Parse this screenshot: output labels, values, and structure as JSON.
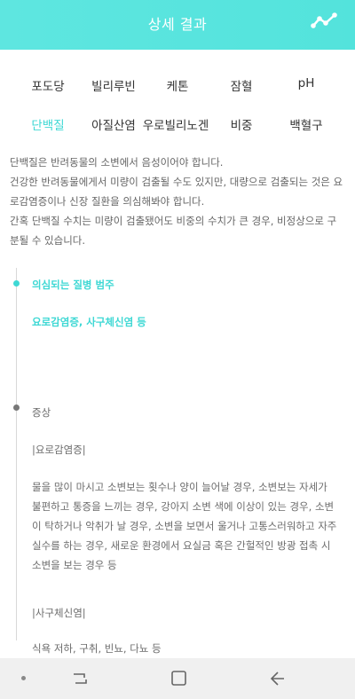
{
  "header": {
    "title": "상세 결과",
    "icon": "trend-line-icon"
  },
  "tabs": {
    "row1": [
      "포도당",
      "빌리루빈",
      "케톤",
      "잠혈",
      "pH"
    ],
    "row2": [
      "단백질",
      "아질산염",
      "우로빌리노겐",
      "비중",
      "백혈구"
    ],
    "active": "단백질"
  },
  "description": [
    "단백질은 반려동물의 소변에서 음성이어야 합니다.",
    "건강한 반려동물에게서 미량이 검출될 수도 있지만, 대량으로 검출되는 것은 요로감염증이나 신장 질환을 의심해봐야 합니다.",
    "간혹 단백질 수치는 미량이 검출됐어도 비중의 수치가 큰 경우, 비정상으로 구분될 수 있습니다."
  ],
  "timeline": {
    "category_label": "의심되는 질병 범주",
    "category_value": "요로감염증, 사구체신염 등",
    "symptoms_label": "증상",
    "disease1": "|요로감염증|",
    "disease1_text": "물을 많이 마시고 소변보는 횟수나 양이 늘어날 경우, 소변보는 자세가 불편하고 통증을 느끼는 경우, 강아지 소변 색에 이상이 있는 경우, 소변이 탁하거나 악취가 날 경우, 소변을 보면서 울거나 고통스러워하고 자주 실수를 하는 경우, 새로운 환경에서 요실금 혹은 간헐적인 방광 접촉 시 소변을 보는 경우 등",
    "disease2": "|사구체신염|",
    "disease2_text": "식욕 저하, 구취, 빈뇨, 다뇨 등"
  },
  "colors": {
    "accent": "#3ed8d4",
    "header": "#56e3dd"
  },
  "navbar": {
    "icons": [
      "nav-dot-icon",
      "recent-apps-icon",
      "home-icon",
      "back-icon"
    ]
  }
}
